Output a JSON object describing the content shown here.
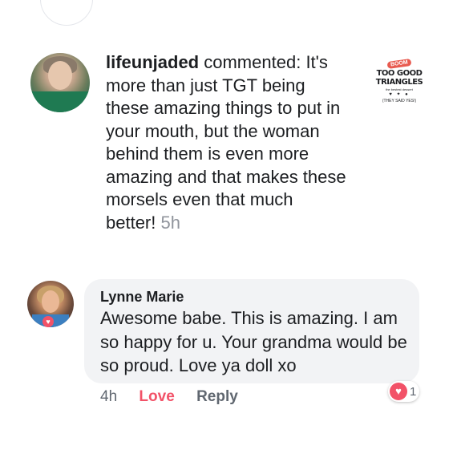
{
  "notification": {
    "username": "lifeunjaded",
    "action": "commented:",
    "comment": "It's more than just TGT being these amazing things to put in your mouth, but the woman behind them is even more amazing and that makes these morsels even that much better!",
    "time": "5h",
    "thumbnail": {
      "boom": "BOOM",
      "brand_line1": "TOO GOOD",
      "brand_line2": "TRIANGLES",
      "tagline": "the bestest dessert",
      "icons": "♥ ✦ ●",
      "they_said_yes": "(THEY SAID YES!)"
    }
  },
  "reply": {
    "author": "Lynne Marie",
    "text": "Awesome babe. This is amazing. I am so happy for u. Your grandma would be so proud. Love ya doll xo",
    "time": "4h",
    "love_label": "Love",
    "reply_label": "Reply",
    "reaction_count": "1"
  },
  "colors": {
    "love_red": "#f25268",
    "bubble_bg": "#f2f3f5",
    "meta_gray": "#606770"
  }
}
